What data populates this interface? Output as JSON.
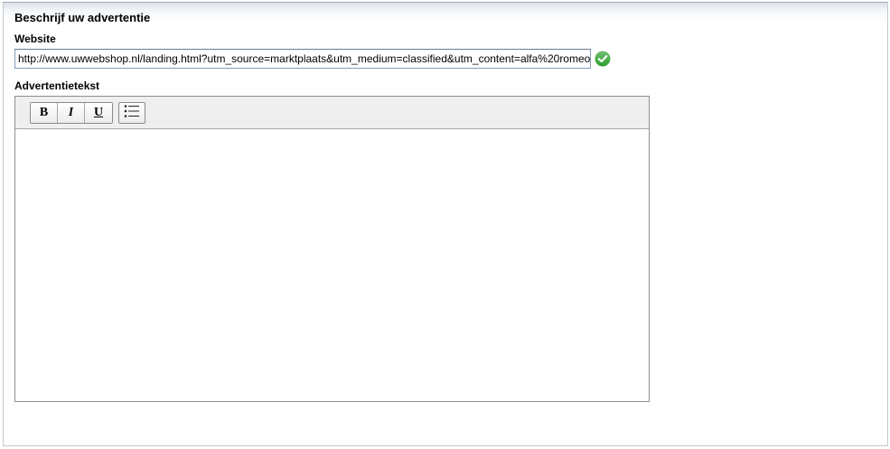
{
  "section": {
    "title": "Beschrijf uw advertentie"
  },
  "website": {
    "label": "Website",
    "value": "http://www.uwwebshop.nl/landing.html?utm_source=marktplaats&utm_medium=classified&utm_content=alfa%20romeo",
    "status_icon": "check-circle-icon",
    "status_color": "#2a9d2a"
  },
  "ad_text": {
    "label": "Advertentietekst",
    "toolbar": {
      "bold_label": "B",
      "italic_label": "I",
      "underline_label": "U",
      "list_icon": "bullet-list-icon"
    },
    "content": ""
  }
}
